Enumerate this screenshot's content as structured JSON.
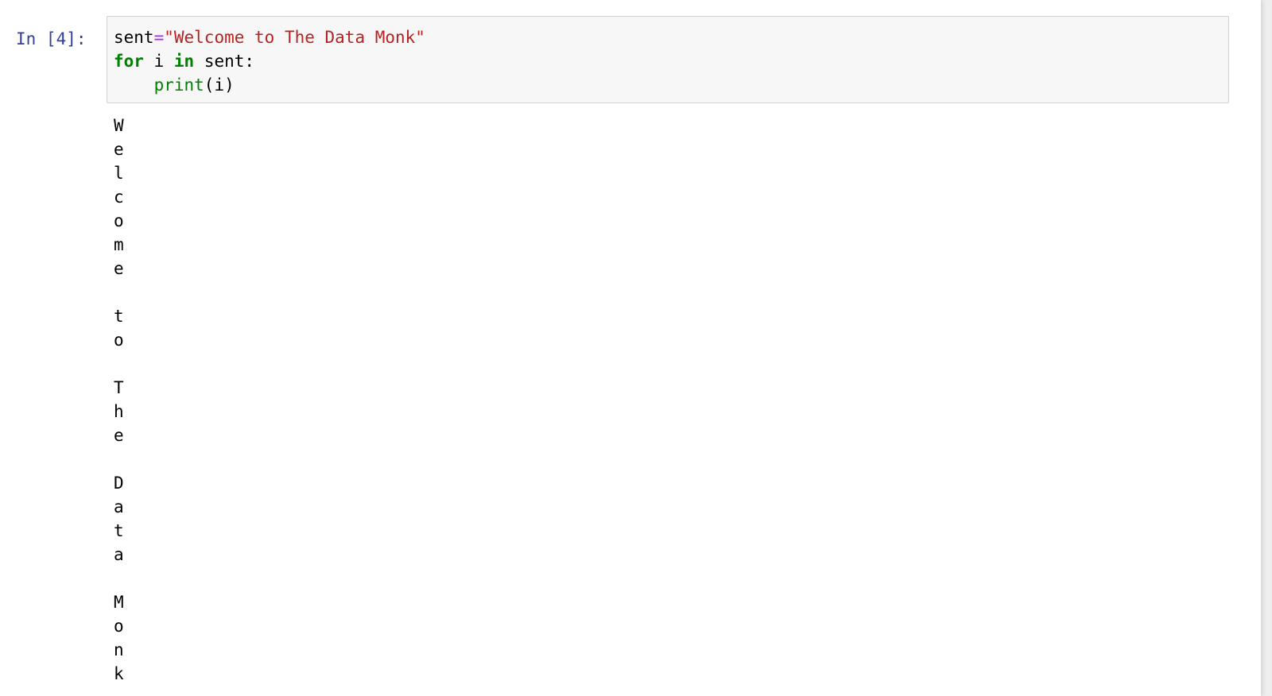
{
  "cell": {
    "prompt": "In [4]:",
    "code": {
      "line1": {
        "var": "sent",
        "op": "=",
        "string": "\"Welcome to The Data Monk\""
      },
      "line2": {
        "kw_for": "for",
        "target": " i ",
        "kw_in": "in",
        "iter": " sent:"
      },
      "line3": {
        "indent": "    ",
        "builtin": "print",
        "args": "(i)"
      }
    },
    "output_lines": [
      "W",
      "e",
      "l",
      "c",
      "o",
      "m",
      "e",
      " ",
      "t",
      "o",
      " ",
      "T",
      "h",
      "e",
      " ",
      "D",
      "a",
      "t",
      "a",
      " ",
      "M",
      "o",
      "n",
      "k"
    ]
  },
  "colors": {
    "prompt": "#303f9f",
    "keyword": "#008000",
    "operator": "#aa22ff",
    "string": "#ba2121",
    "input_background": "#f7f7f7",
    "input_border": "#cfcfcf"
  }
}
